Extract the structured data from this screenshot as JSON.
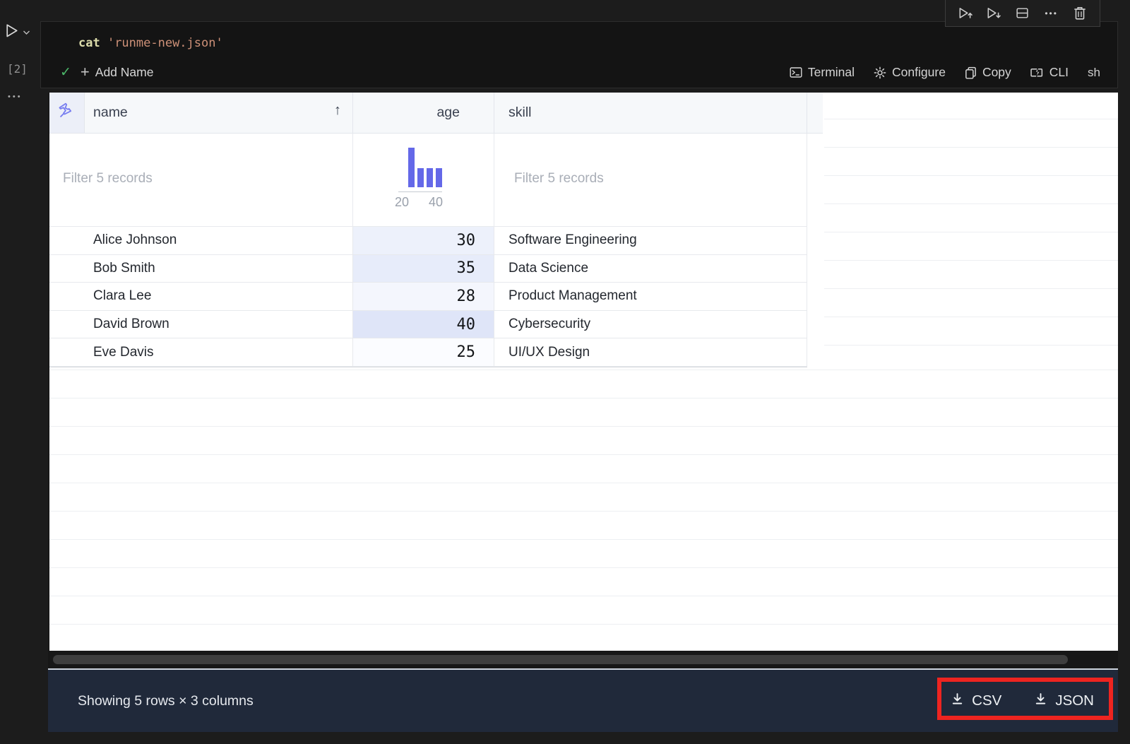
{
  "cell": {
    "execution_count": "[2]",
    "code_keyword": "cat",
    "code_string": " 'runme-new.json'",
    "add_name_label": "Add Name",
    "terminal_label": "Terminal",
    "configure_label": "Configure",
    "copy_label": "Copy",
    "cli_label": "CLI",
    "language_label": "sh",
    "toolbar_icons": [
      "execute-above",
      "execute-below",
      "split-cell",
      "more-actions",
      "delete-cell"
    ]
  },
  "table": {
    "columns": [
      {
        "label": "name",
        "sort": "ascending",
        "sort_icon": "↑"
      },
      {
        "label": "age"
      },
      {
        "label": "skill"
      }
    ],
    "filters": {
      "name": "Filter 5 records",
      "skill": "Filter 5 records"
    },
    "rows": [
      {
        "name": "Alice Johnson",
        "age": "30",
        "skill": "Software Engineering"
      },
      {
        "name": "Bob Smith",
        "age": "35",
        "skill": "Data Science"
      },
      {
        "name": "Clara Lee",
        "age": "28",
        "skill": "Product Management"
      },
      {
        "name": "David Brown",
        "age": "40",
        "skill": "Cybersecurity"
      },
      {
        "name": "Eve Davis",
        "age": "25",
        "skill": "UI/UX Design"
      }
    ]
  },
  "chart_data": {
    "type": "bar",
    "context": "age-column-filter-histogram",
    "values": [
      2,
      1,
      1,
      1
    ],
    "x_ticks": [
      "20",
      "40"
    ],
    "source_column": "age",
    "source_values": [
      30,
      35,
      28,
      40,
      25
    ]
  },
  "footer": {
    "summary": "Showing 5 rows × 3 columns",
    "csv_label": "CSV",
    "json_label": "JSON"
  },
  "colors": {
    "accent_indigo": "#6468e8",
    "annotation_red": "#ee2420",
    "footer_bg": "#20293a",
    "success_green": "#4cb96a",
    "keyword_yellow": "#dcdcaa",
    "string_orange": "#ce9178"
  }
}
